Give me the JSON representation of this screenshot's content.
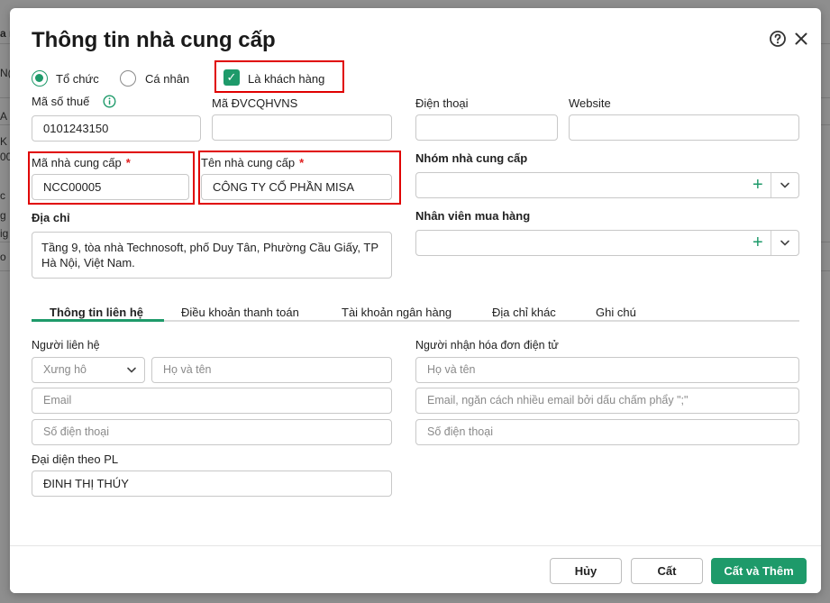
{
  "background": {
    "fragments": [
      "a n",
      "N(",
      "A",
      "K",
      "00",
      "c",
      "g",
      "ig",
      "o N"
    ]
  },
  "dialog": {
    "title": "Thông tin nhà cung cấp"
  },
  "type_options": {
    "organization": "Tổ chức",
    "individual": "Cá nhân",
    "is_customer": "Là khách hàng"
  },
  "fields": {
    "tax_code_label": "Mã số thuế",
    "tax_code_value": "0101243150",
    "budget_code_label": "Mã ĐVCQHVNS",
    "budget_code_value": "",
    "phone_label": "Điện thoại",
    "phone_value": "",
    "website_label": "Website",
    "website_value": "",
    "supplier_code_label": "Mã nhà cung cấp",
    "supplier_code_value": "NCC00005",
    "supplier_name_label": "Tên nhà cung cấp",
    "supplier_name_value": "CÔNG TY CỔ PHẦN MISA",
    "required_mark": "*",
    "supplier_group_label": "Nhóm nhà cung cấp",
    "address_label": "Địa chỉ",
    "address_value": "Tầng 9, tòa nhà Technosoft, phố Duy Tân, Phường Cầu Giấy, TP Hà Nội, Việt Nam.",
    "purchaser_label": "Nhân viên mua hàng"
  },
  "tabs": [
    {
      "label": "Thông tin liên hệ",
      "active": true
    },
    {
      "label": "Điều khoản thanh toán",
      "active": false
    },
    {
      "label": "Tài khoản ngân hàng",
      "active": false
    },
    {
      "label": "Địa chỉ khác",
      "active": false
    },
    {
      "label": "Ghi chú",
      "active": false
    }
  ],
  "contact": {
    "section_label": "Người liên hệ",
    "salutation_placeholder": "Xưng hô",
    "name_placeholder": "Họ và tên",
    "email_placeholder": "Email",
    "phone_placeholder": "Số điện thoại",
    "legal_rep_label": "Đại diện theo PL",
    "legal_rep_value": "ĐINH THỊ THÚY"
  },
  "einvoice": {
    "section_label": "Người nhận hóa đơn điện tử",
    "name_placeholder": "Họ và tên",
    "email_placeholder": "Email, ngăn cách nhiều email bởi dấu chấm phẩy \";\"",
    "phone_placeholder": "Số điện thoại"
  },
  "footer": {
    "cancel": "Hủy",
    "save": "Cất",
    "save_add": "Cất và Thêm"
  },
  "colors": {
    "accent": "#1e9a6a",
    "highlight": "#e00000"
  }
}
